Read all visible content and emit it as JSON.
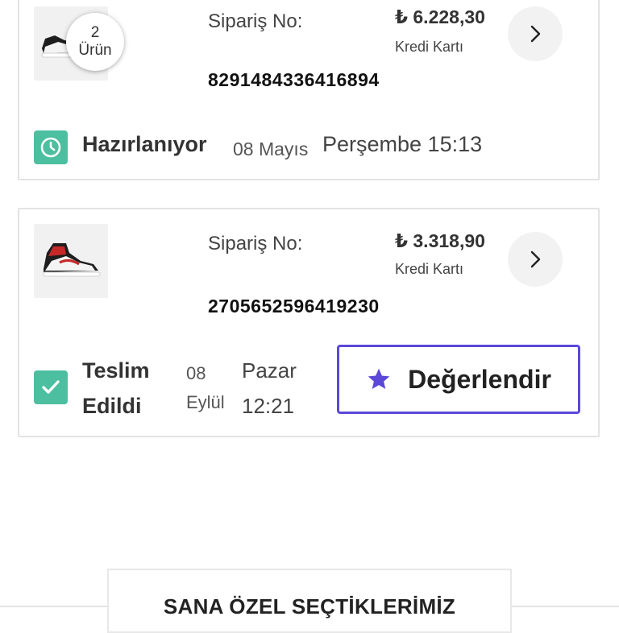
{
  "orders": [
    {
      "item_count": "2",
      "item_count_unit": "Ürün",
      "order_label": "Sipariş No:",
      "order_number": "8291484336416894",
      "price": "₺ 6.228,30",
      "payment_method": "Kredi Kartı",
      "status": "Hazırlanıyor",
      "status_icon": "clock-icon",
      "date": "08 Mayıs",
      "time": "Perşembe 15:13"
    },
    {
      "order_label": "Sipariş No:",
      "order_number": "2705652596419230",
      "price": "₺ 3.318,90",
      "payment_method": "Kredi Kartı",
      "status": "Teslim Edildi",
      "status_icon": "checkmark-icon",
      "date": "08 Eylül",
      "time": "Pazar 12:21",
      "rate_button_label": "Değerlendir",
      "rate_button_icon": "star-icon"
    }
  ],
  "section_title": "SANA ÖZEL SEÇTİKLERİMİZ",
  "colors": {
    "status_green": "#4bbf9f",
    "accent_purple": "#5b48d9",
    "border": "#e3e3e3"
  }
}
